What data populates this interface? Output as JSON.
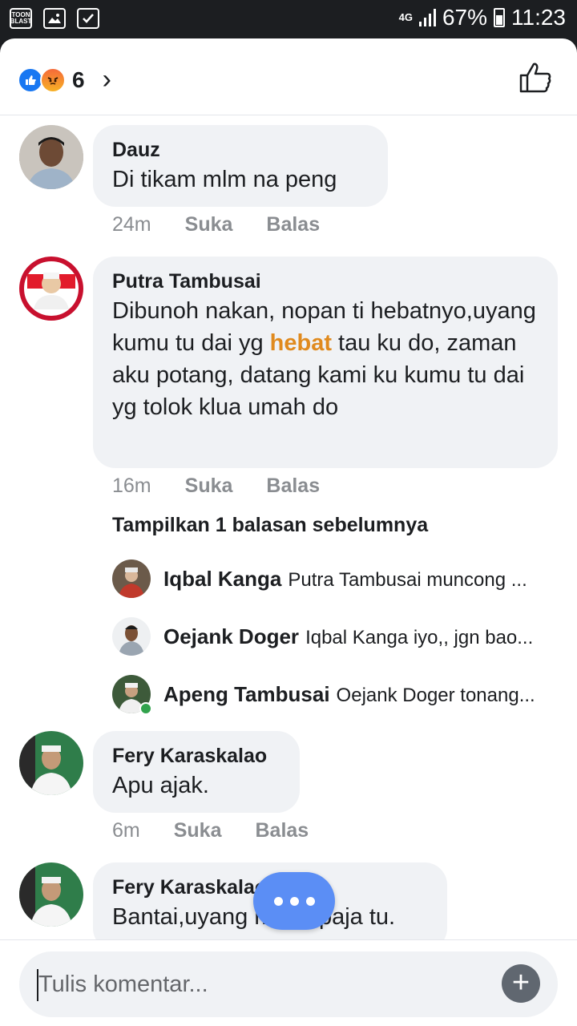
{
  "status_bar": {
    "app_icon_text": "TOON BLAST",
    "network": "4G",
    "battery": "67%",
    "time": "11:23"
  },
  "header": {
    "reaction_count": "6",
    "reactions": [
      "like-icon",
      "angry-icon"
    ],
    "like_button_icon": "thumbs-up-icon"
  },
  "comments": [
    {
      "author": "Dauz",
      "text": "Di tikam mlm na peng",
      "time": "24m",
      "like": "Suka",
      "reply": "Balas"
    },
    {
      "author": "Putra Tambusai",
      "text_before": "Dibunoh nakan, nopan ti hebatnyo,uyang kumu tu dai yg ",
      "text_highlight": "hebat",
      "text_after": " tau ku do, zaman aku potang, datang kami ku kumu tu dai yg tolok klua umah do",
      "time": "16m",
      "like": "Suka",
      "reply": "Balas"
    },
    {
      "author": "Fery Karaskalao",
      "text": "Apu ajak.",
      "time": "6m",
      "like": "Suka",
      "reply": "Balas"
    },
    {
      "author": "Fery Karaskalao",
      "text": "Bantai,uyang mano paja tu."
    }
  ],
  "replies_section": {
    "show_previous": "Tampilkan 1 balasan sebelumnya",
    "replies": [
      {
        "name": "Iqbal Kanga",
        "text": "Putra Tambusai muncong ..."
      },
      {
        "name": "Oejank Doger",
        "text": "Iqbal Kanga iyo,, jgn bao..."
      },
      {
        "name": "Apeng Tambusai",
        "text": "Oejank Doger tonang..."
      }
    ]
  },
  "composer": {
    "placeholder": "Tulis komentar..."
  },
  "colors": {
    "accent_blue": "#1877f2",
    "fab_blue": "#5b8ef5",
    "highlight": "#e08a1e",
    "bubble_bg": "#f0f2f5"
  }
}
